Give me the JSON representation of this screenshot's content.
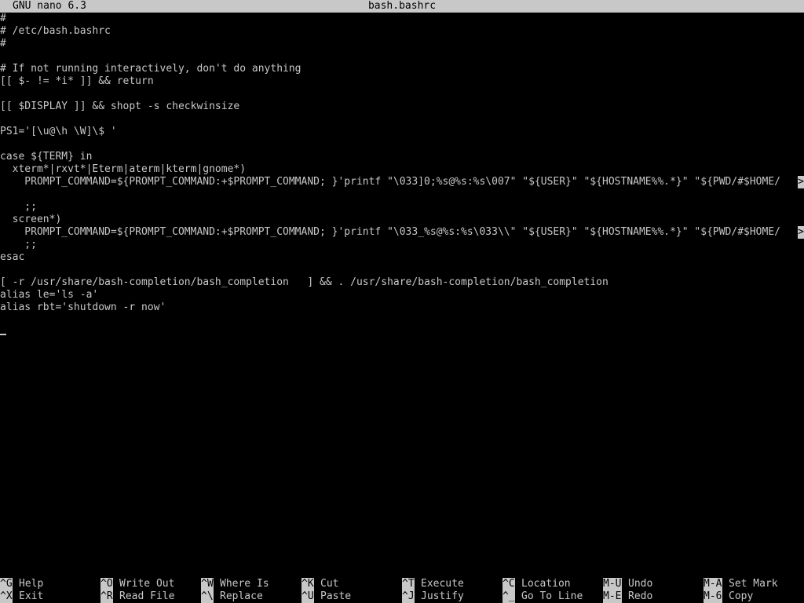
{
  "titlebar": {
    "app": "GNU nano 6.3",
    "filename": "bash.bashrc"
  },
  "editor": {
    "lines": [
      {
        "text": "#",
        "overflow": false
      },
      {
        "text": "# /etc/bash.bashrc",
        "overflow": false
      },
      {
        "text": "#",
        "overflow": false
      },
      {
        "text": "",
        "overflow": false
      },
      {
        "text": "# If not running interactively, don't do anything",
        "overflow": false
      },
      {
        "text": "[[ $- != *i* ]] && return",
        "overflow": false
      },
      {
        "text": "",
        "overflow": false
      },
      {
        "text": "[[ $DISPLAY ]] && shopt -s checkwinsize",
        "overflow": false
      },
      {
        "text": "",
        "overflow": false
      },
      {
        "text": "PS1='[\\u@\\h \\W]\\$ '",
        "overflow": false
      },
      {
        "text": "",
        "overflow": false
      },
      {
        "text": "case ${TERM} in",
        "overflow": false
      },
      {
        "text": "  xterm*|rxvt*|Eterm|aterm|kterm|gnome*)",
        "overflow": false
      },
      {
        "text": "    PROMPT_COMMAND=${PROMPT_COMMAND:+$PROMPT_COMMAND; }'printf \"\\033]0;%s@%s:%s\\007\" \"${USER}\" \"${HOSTNAME%%.*}\" \"${PWD/#$HOME/",
        "overflow": true
      },
      {
        "text": "",
        "overflow": false
      },
      {
        "text": "    ;;",
        "overflow": false
      },
      {
        "text": "  screen*)",
        "overflow": false
      },
      {
        "text": "    PROMPT_COMMAND=${PROMPT_COMMAND:+$PROMPT_COMMAND; }'printf \"\\033_%s@%s:%s\\033\\\\\" \"${USER}\" \"${HOSTNAME%%.*}\" \"${PWD/#$HOME/",
        "overflow": true
      },
      {
        "text": "    ;;",
        "overflow": false
      },
      {
        "text": "esac",
        "overflow": false
      },
      {
        "text": "",
        "overflow": false
      },
      {
        "text": "[ -r /usr/share/bash-completion/bash_completion   ] && . /usr/share/bash-completion/bash_completion",
        "overflow": false
      },
      {
        "text": "alias le='ls -a'",
        "overflow": false
      },
      {
        "text": "alias rbt='shutdown -r now'",
        "overflow": false
      },
      {
        "text": "",
        "overflow": false
      },
      {
        "text": "",
        "overflow": false,
        "cursor": true
      }
    ],
    "overflow_marker": ">"
  },
  "shortcuts": [
    {
      "key": "^G",
      "label": "Help",
      "name": "shortcut-help"
    },
    {
      "key": "^X",
      "label": "Exit",
      "name": "shortcut-exit"
    },
    {
      "key": "^O",
      "label": "Write Out",
      "name": "shortcut-write-out"
    },
    {
      "key": "^R",
      "label": "Read File",
      "name": "shortcut-read-file"
    },
    {
      "key": "^W",
      "label": "Where Is",
      "name": "shortcut-where-is"
    },
    {
      "key": "^\\",
      "label": "Replace",
      "name": "shortcut-replace"
    },
    {
      "key": "^K",
      "label": "Cut",
      "name": "shortcut-cut"
    },
    {
      "key": "^U",
      "label": "Paste",
      "name": "shortcut-paste"
    },
    {
      "key": "^T",
      "label": "Execute",
      "name": "shortcut-execute"
    },
    {
      "key": "^J",
      "label": "Justify",
      "name": "shortcut-justify"
    },
    {
      "key": "^C",
      "label": "Location",
      "name": "shortcut-location"
    },
    {
      "key": "^_",
      "label": "Go To Line",
      "name": "shortcut-go-to-line"
    },
    {
      "key": "M-U",
      "label": "Undo",
      "name": "shortcut-undo"
    },
    {
      "key": "M-E",
      "label": "Redo",
      "name": "shortcut-redo"
    },
    {
      "key": "M-A",
      "label": "Set Mark",
      "name": "shortcut-set-mark"
    },
    {
      "key": "M-6",
      "label": "Copy",
      "name": "shortcut-copy"
    }
  ],
  "colors": {
    "background": "#000000",
    "foreground": "#c8c8c8",
    "inverse_bg": "#c8c8c8",
    "inverse_fg": "#000000"
  }
}
